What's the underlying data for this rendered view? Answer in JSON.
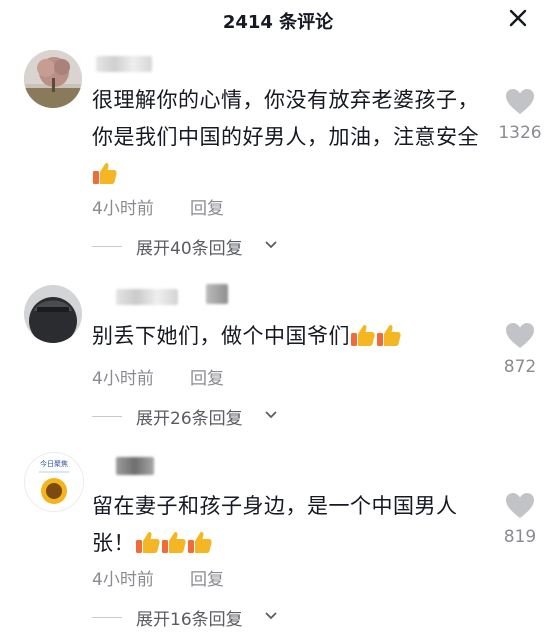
{
  "header": {
    "title": "2414 条评论"
  },
  "comments": [
    {
      "text": "很理解你的心情，你没有放弃老婆孩子，你是我们中国的好男人，加油，注意安全",
      "thumbs": 1,
      "time": "4小时前",
      "reply_label": "回复",
      "expand_label": "展开40条回复",
      "likes": "1326"
    },
    {
      "text": "别丢下她们，做个中国爷们",
      "thumbs": 2,
      "time": "4小时前",
      "reply_label": "回复",
      "expand_label": "展开26条回复",
      "likes": "872"
    },
    {
      "text": "留在妻子和孩子身边，是一个中国男人张！",
      "thumbs": 3,
      "time": "4小时前",
      "reply_label": "回复",
      "expand_label": "展开16条回复",
      "likes": "819"
    }
  ],
  "avatar3_caption": "今日聚焦"
}
